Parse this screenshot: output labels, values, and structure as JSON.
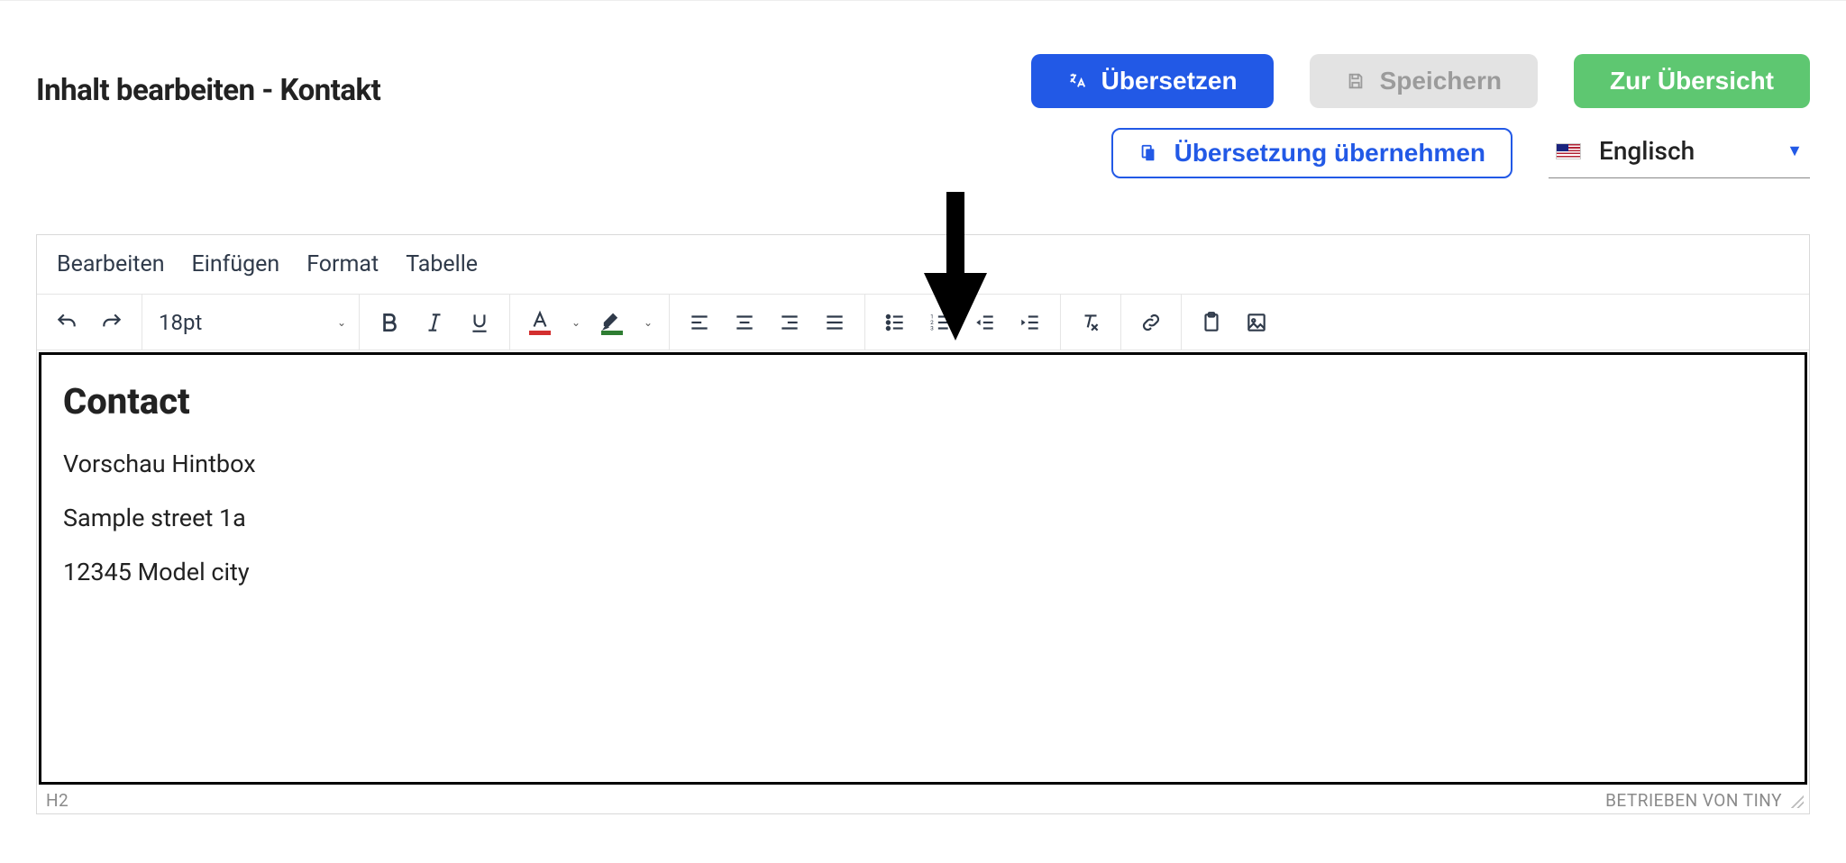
{
  "page_title": "Inhalt bearbeiten - Kontakt",
  "buttons": {
    "translate": "Übersetzen",
    "save": "Speichern",
    "overview": "Zur Übersicht",
    "apply_translation": "Übersetzung übernehmen"
  },
  "language": {
    "label": "Englisch"
  },
  "editor": {
    "menubar": [
      "Bearbeiten",
      "Einfügen",
      "Format",
      "Tabelle"
    ],
    "font_size": "18pt",
    "status_path": "H2",
    "branding": "BETRIEBEN VON TINY"
  },
  "content": {
    "heading": "Contact",
    "lines": [
      "Vorschau Hintbox",
      "Sample street 1a",
      "12345 Model city"
    ]
  },
  "colors": {
    "primary": "#2259e6",
    "success": "#5ec771",
    "disabled_bg": "#e3e3e3",
    "disabled_fg": "#9b9b9b"
  }
}
